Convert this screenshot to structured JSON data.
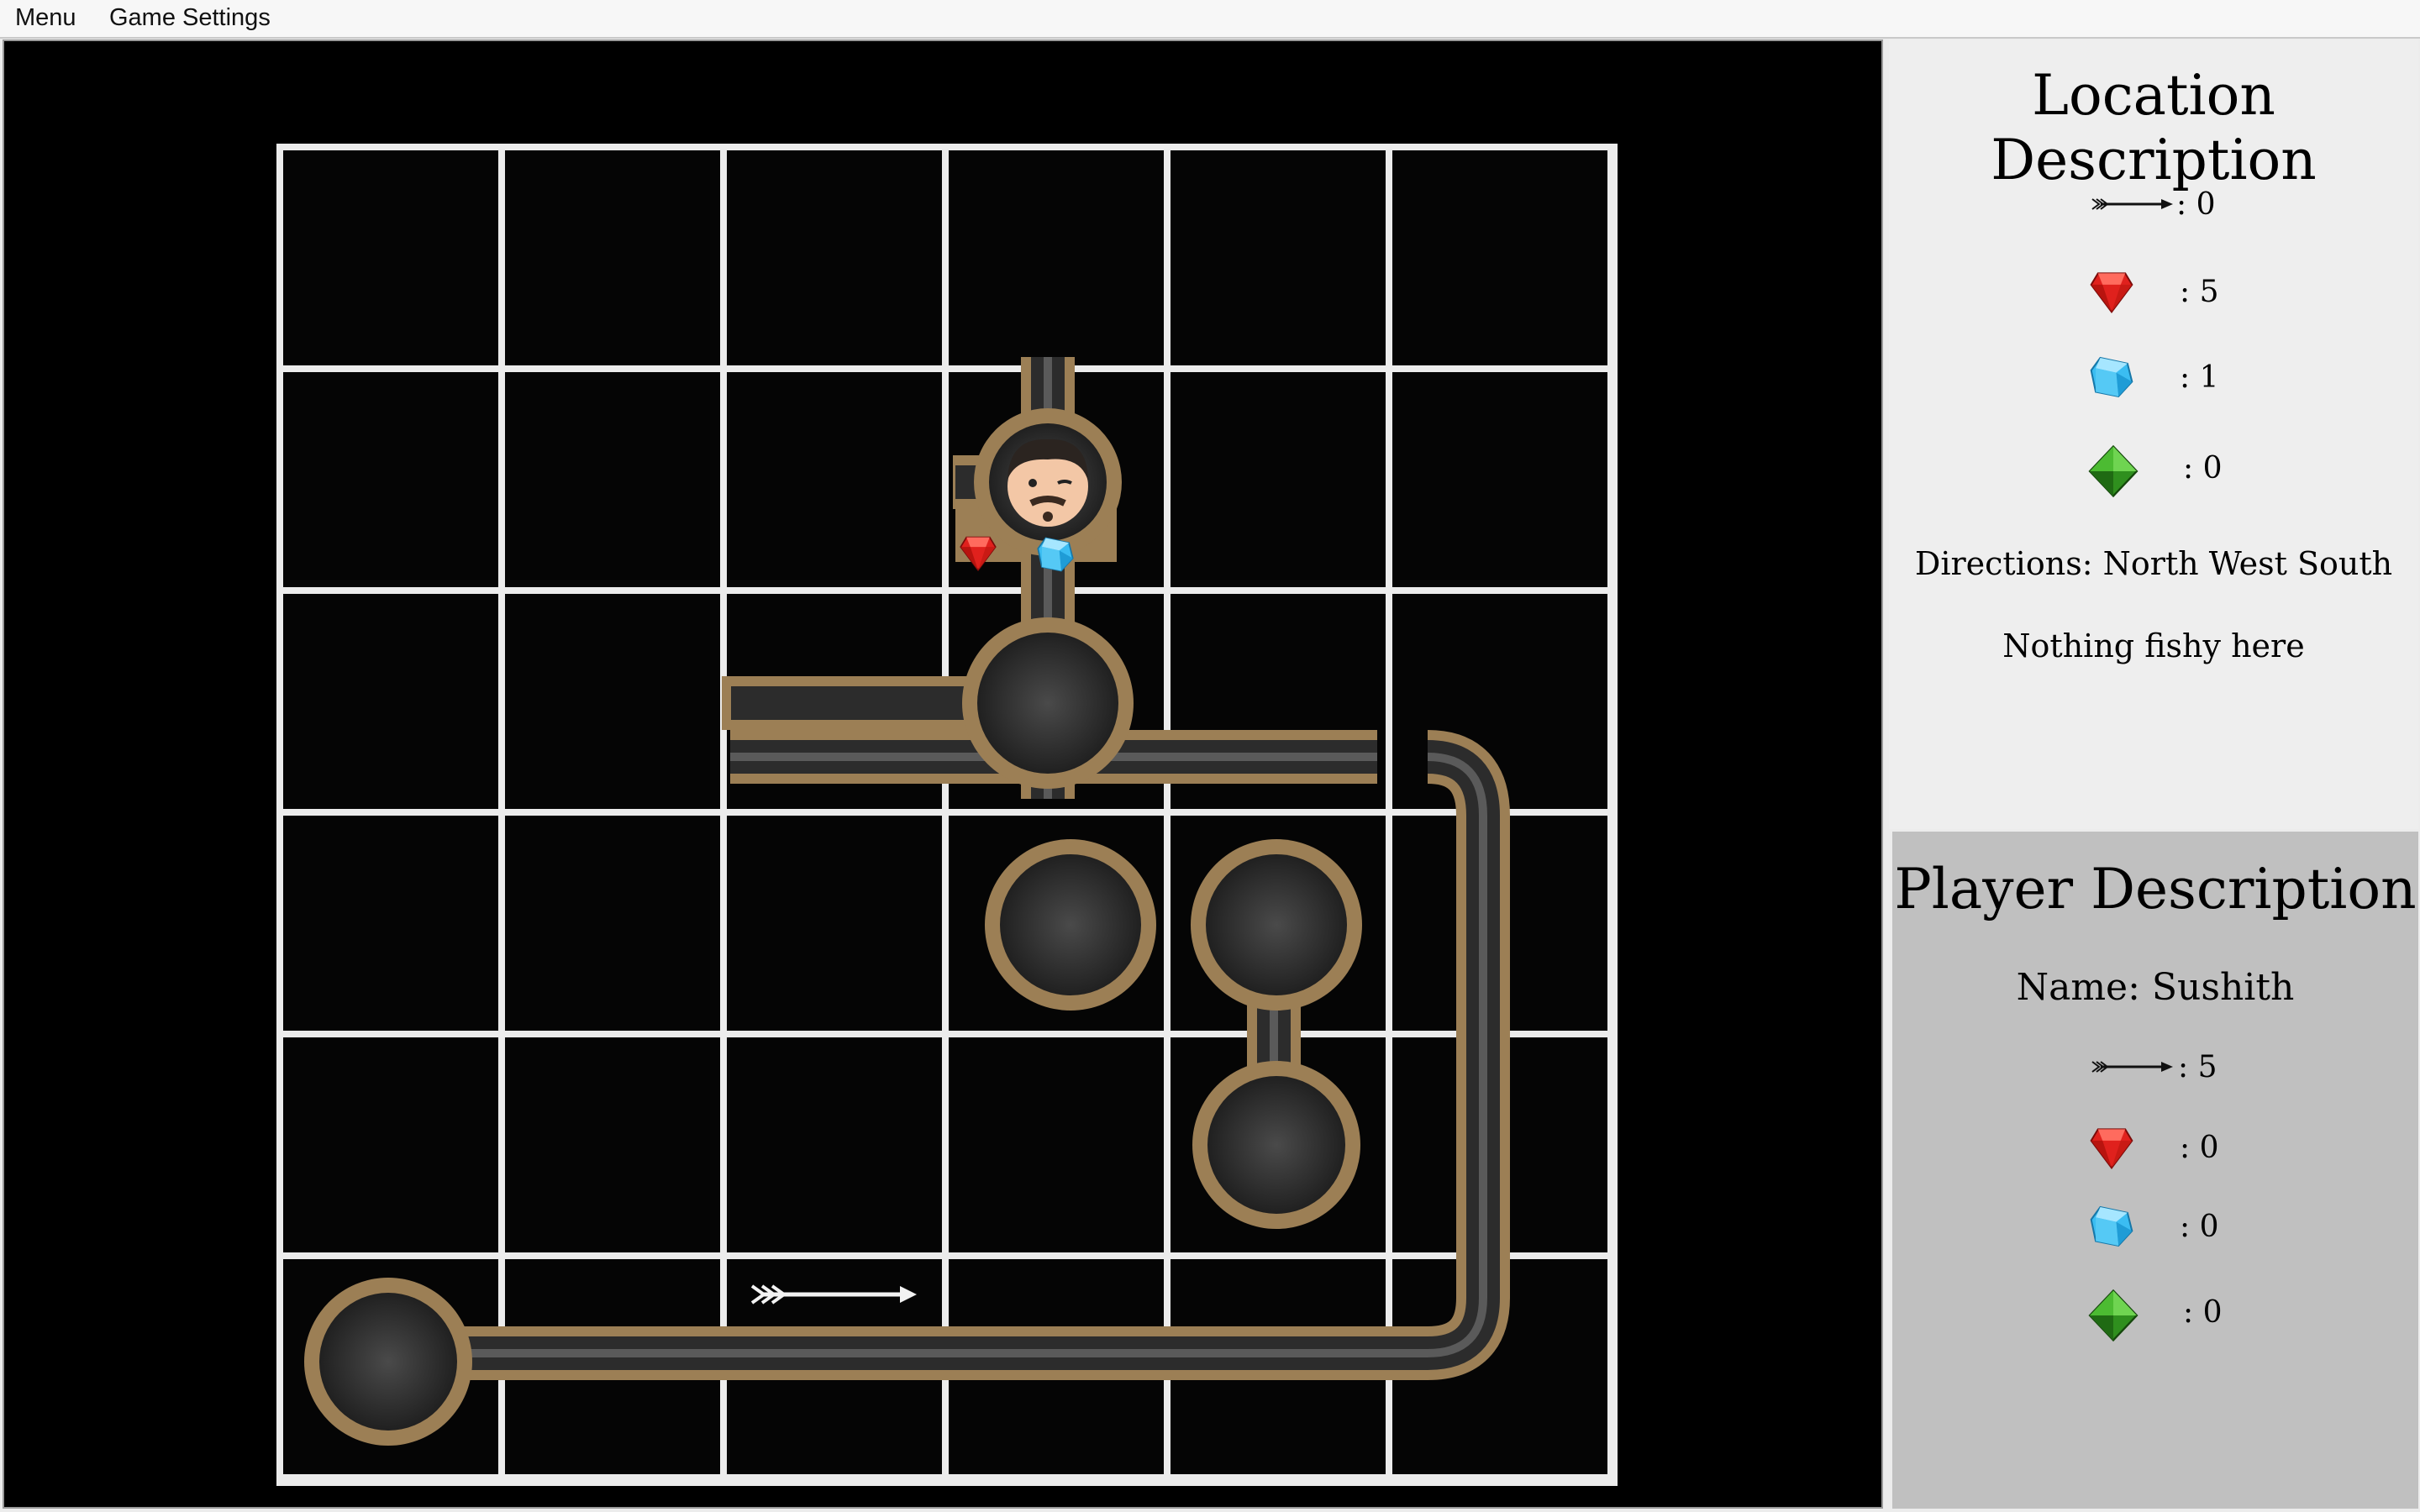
{
  "menu_bar": {
    "menu_label": "Menu",
    "settings_label": "Game Settings"
  },
  "board": {
    "rows": 6,
    "cols": 6,
    "player_cell": "row 2, col 4",
    "arrow_cell": "row 6, col 3",
    "item_icons": [
      "player-avatar",
      "red-gem",
      "blue-gem",
      "arrow"
    ]
  },
  "location": {
    "title": "Location Description",
    "arrows": ": 0",
    "red_gems": ": 5",
    "blue_gems": ": 1",
    "green_gems": ": 0",
    "directions": "Directions: North West South",
    "smell": "Nothing fishy here"
  },
  "player": {
    "title": "Player Description",
    "name": "Name: Sushith",
    "arrows": ": 5",
    "red_gems": ": 0",
    "blue_gems": ": 0",
    "green_gems": ": 0"
  },
  "colors": {
    "tunnel_border": "#9c7f55",
    "tunnel_floor": "#3a3a3a",
    "grid_line": "#ececec",
    "ruby": "#e0211d",
    "diamond": "#35b7ee",
    "emerald": "#2f8f1e"
  }
}
